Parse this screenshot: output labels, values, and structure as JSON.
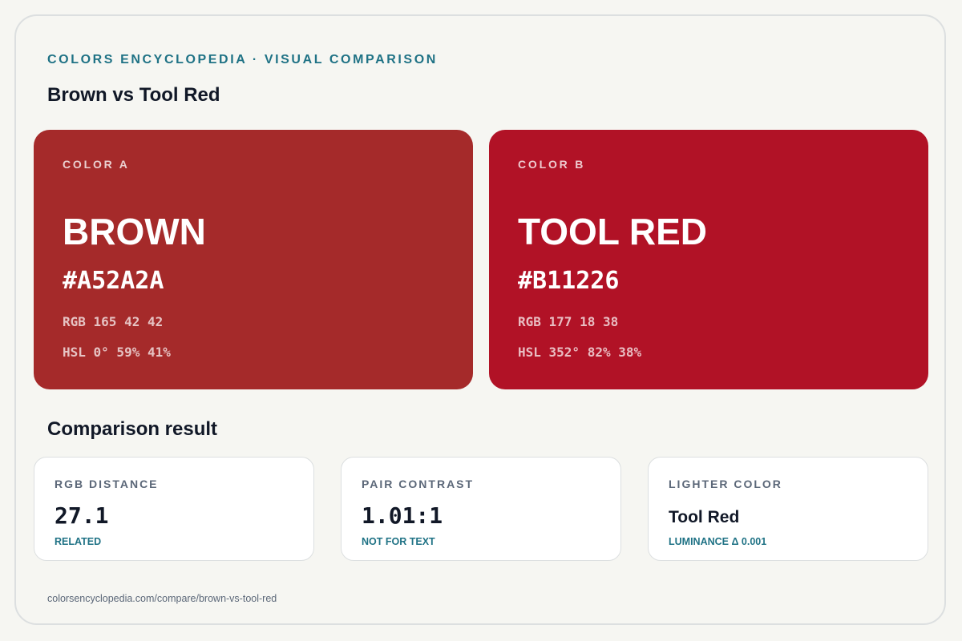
{
  "header": {
    "eyebrow": "COLORS ENCYCLOPEDIA · VISUAL COMPARISON",
    "title": "Brown vs Tool Red"
  },
  "colors": {
    "a": {
      "label": "COLOR A",
      "name": "BROWN",
      "hex": "#A52A2A",
      "rgb": "RGB 165 42 42",
      "hsl": "HSL 0° 59% 41%",
      "swatch": "#A52A2A"
    },
    "b": {
      "label": "COLOR B",
      "name": "TOOL RED",
      "hex": "#B11226",
      "rgb": "RGB 177 18 38",
      "hsl": "HSL 352° 82% 38%",
      "swatch": "#B11226"
    }
  },
  "comparison": {
    "title": "Comparison result",
    "cards": [
      {
        "label": "RGB DISTANCE",
        "value": "27.1",
        "note": "RELATED"
      },
      {
        "label": "PAIR CONTRAST",
        "value": "1.01:1",
        "note": "NOT FOR TEXT"
      },
      {
        "label": "LIGHTER COLOR",
        "value": "Tool Red",
        "note": "LUMINANCE Δ 0.001"
      }
    ]
  },
  "footer": {
    "url": "colorsencyclopedia.com/compare/brown-vs-tool-red"
  },
  "theme": {
    "accent": "#1f7285",
    "background": "#f6f6f2",
    "text": "#111827",
    "muted": "#5b6778"
  }
}
